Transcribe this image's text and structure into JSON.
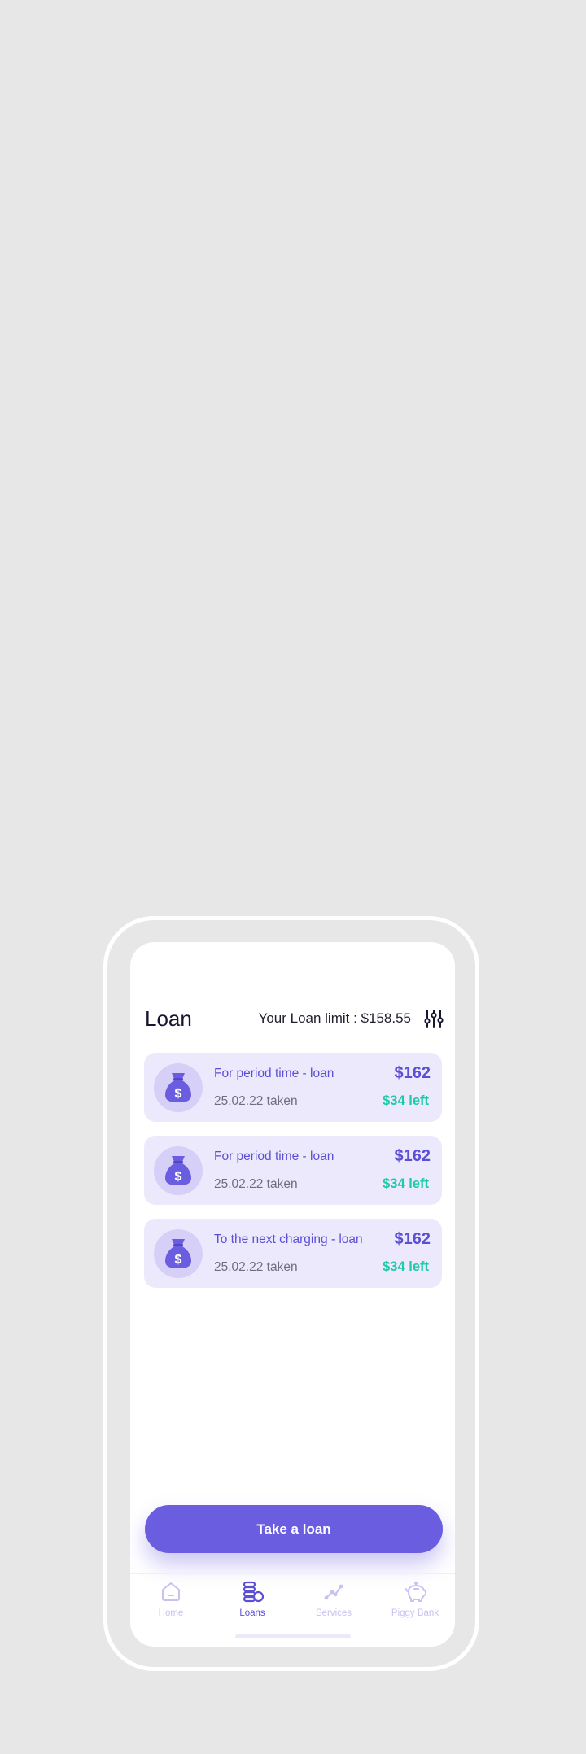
{
  "header": {
    "title": "Loan",
    "loan_limit_text": "Your Loan limit : $158.55",
    "filter_icon": "sliders-icon"
  },
  "loans": [
    {
      "name": "For period time - loan",
      "date": "25.02.22 taken",
      "amount": "$162",
      "left": "$34 left",
      "icon": "money-bag-icon"
    },
    {
      "name": "For period time - loan",
      "date": "25.02.22 taken",
      "amount": "$162",
      "left": "$34 left",
      "icon": "money-bag-icon"
    },
    {
      "name": "To the next charging - loan",
      "date": "25.02.22 taken",
      "amount": "$162",
      "left": "$34 left",
      "icon": "money-bag-icon"
    }
  ],
  "cta": {
    "label": "Take a loan"
  },
  "tabs": [
    {
      "label": "Home",
      "icon": "home-icon",
      "active": false
    },
    {
      "label": "Loans",
      "icon": "coins-icon",
      "active": true
    },
    {
      "label": "Services",
      "icon": "chart-line-icon",
      "active": false
    },
    {
      "label": "Piggy Bank",
      "icon": "piggy-bank-icon",
      "active": false
    }
  ],
  "colors": {
    "accent": "#6A5DE0",
    "card_background": "#ECE9FD",
    "positive": "#21C9A8",
    "inactive_tab": "#C7C1F3"
  }
}
